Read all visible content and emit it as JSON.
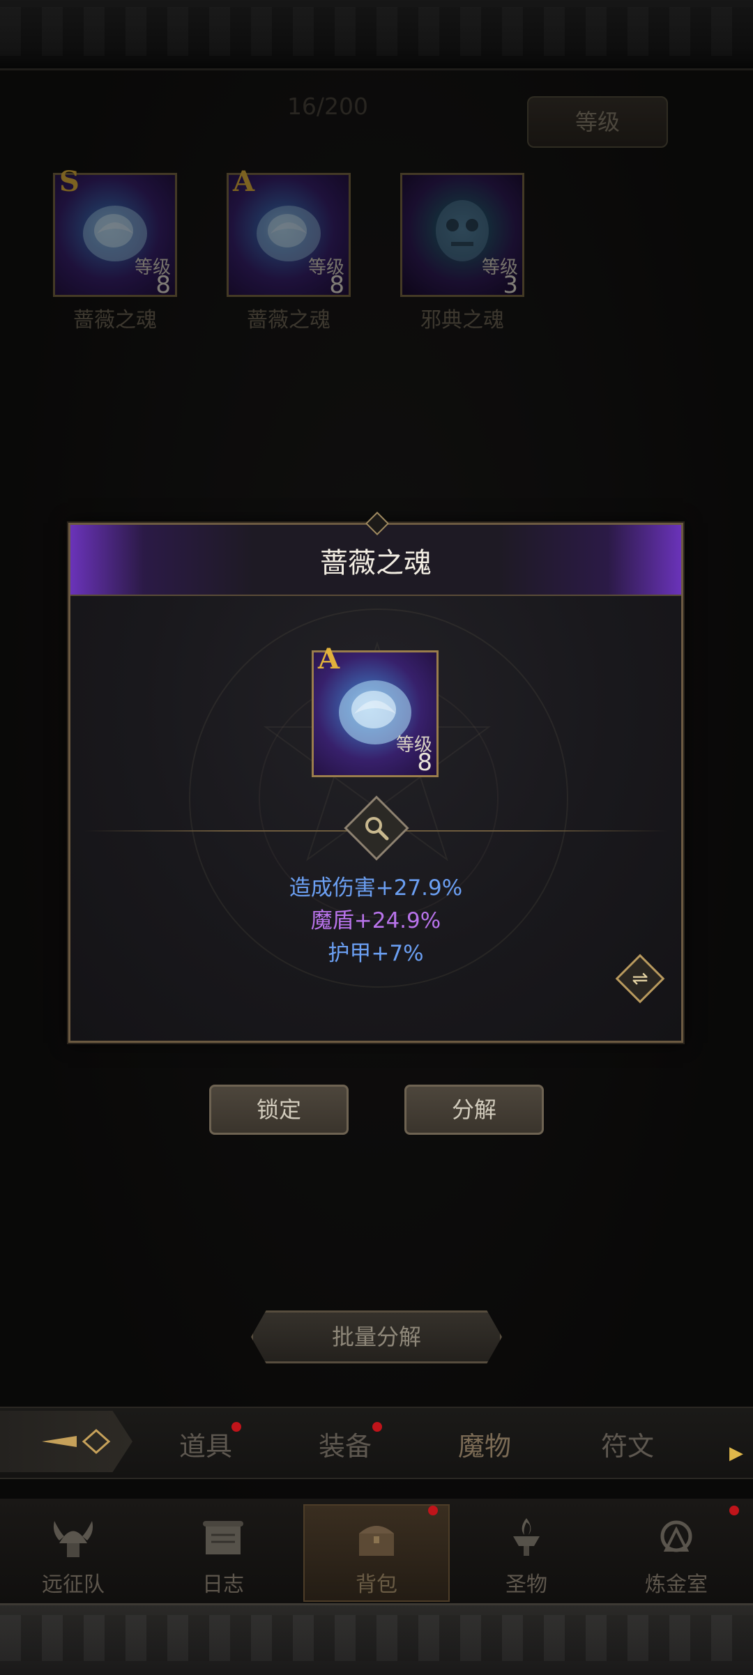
{
  "inventory": {
    "count": "16/200",
    "sort_label": "等级",
    "items": [
      {
        "rank": "S",
        "level_label": "等级",
        "level": "8",
        "name": "蔷薇之魂"
      },
      {
        "rank": "A",
        "level_label": "等级",
        "level": "8",
        "name": "蔷薇之魂"
      },
      {
        "rank": "",
        "level_label": "等级",
        "level": "3",
        "name": "邪典之魂"
      }
    ]
  },
  "modal": {
    "title": "蔷薇之魂",
    "item": {
      "rank": "A",
      "level_label": "等级",
      "level": "8"
    },
    "stats": [
      "造成伤害+27.9%",
      "魔盾+24.9%",
      "护甲+7%"
    ],
    "stat_colors": [
      "#6b9ff2",
      "#b873ea",
      "#6b9ff2"
    ]
  },
  "actions": {
    "lock_label": "锁定",
    "dismantle_label": "分解",
    "bulk_label": "批量分解"
  },
  "tabs": [
    {
      "label": "道具",
      "badge": true
    },
    {
      "label": "装备",
      "badge": true
    },
    {
      "label": "魔物",
      "badge": false,
      "active": true
    },
    {
      "label": "符文",
      "badge": false
    }
  ],
  "nav": [
    {
      "label": "远征队",
      "icon": "viking-helmet-icon"
    },
    {
      "label": "日志",
      "icon": "scroll-icon"
    },
    {
      "label": "背包",
      "icon": "treasure-chest-icon",
      "active": true,
      "badge": true
    },
    {
      "label": "圣物",
      "icon": "brazier-icon"
    },
    {
      "label": "炼金室",
      "icon": "alchemy-icon",
      "badge": true
    }
  ]
}
